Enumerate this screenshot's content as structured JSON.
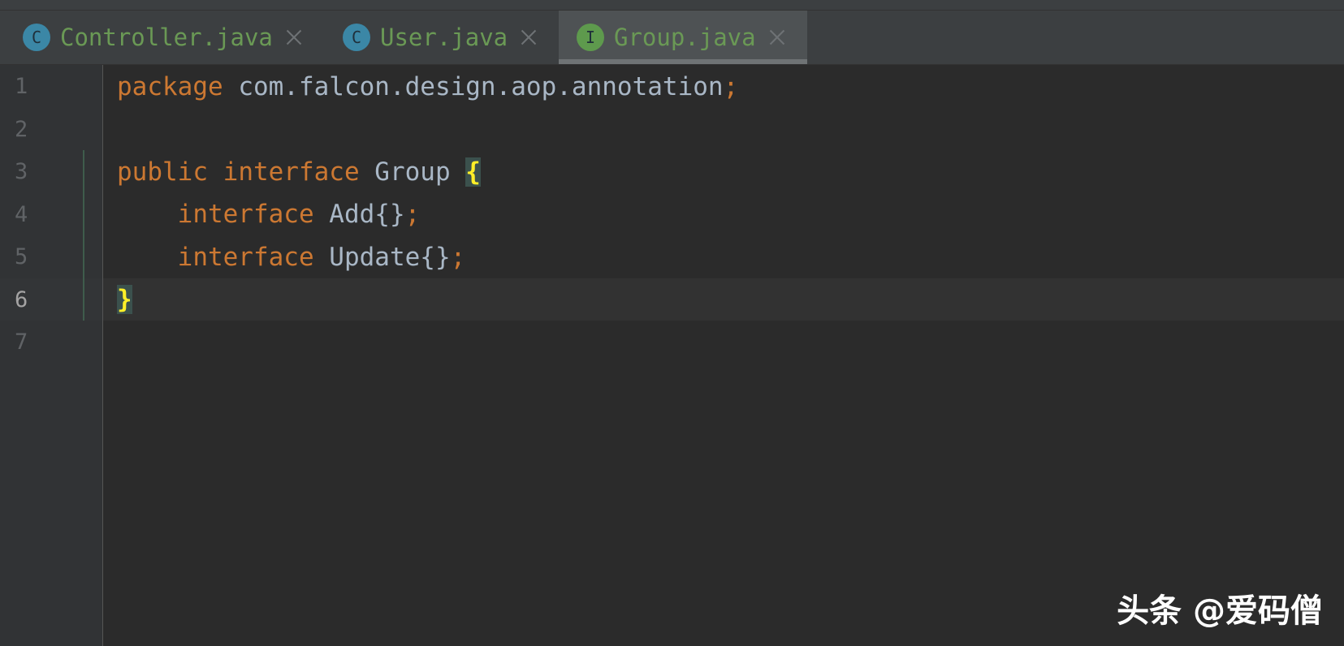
{
  "tabs": [
    {
      "icon_letter": "C",
      "icon_name": "class-icon",
      "icon_color": "#3b87a6",
      "label": "Controller.java",
      "active": false
    },
    {
      "icon_letter": "C",
      "icon_name": "class-icon",
      "icon_color": "#3b87a6",
      "label": "User.java",
      "active": false
    },
    {
      "icon_letter": "I",
      "icon_name": "interface-icon",
      "icon_color": "#5e9a4d",
      "label": "Group.java",
      "active": true
    }
  ],
  "editor": {
    "line_numbers": [
      "1",
      "2",
      "3",
      "4",
      "5",
      "6",
      "7"
    ],
    "current_line": 6,
    "lines": {
      "l1_kw": "package",
      "l1_rest": " com.falcon.design.aop.annotation",
      "l1_semi": ";",
      "l3_kw1": "public",
      "l3_kw2": "interface",
      "l3_name": " Group ",
      "l3_brace": "{",
      "l4_indent": "    ",
      "l4_kw": "interface",
      "l4_name": " Add{}",
      "l4_semi": ";",
      "l5_indent": "    ",
      "l5_kw": "interface",
      "l5_name": " Update{}",
      "l5_semi": ";",
      "l6_brace": "}"
    }
  },
  "colors": {
    "background": "#2b2b2b",
    "keyword": "#cc7832",
    "identifier": "#a9b7c6",
    "tab_label": "#6a9955",
    "brace_highlight": "#ffef28"
  },
  "watermark": "头条 @爱码僧"
}
